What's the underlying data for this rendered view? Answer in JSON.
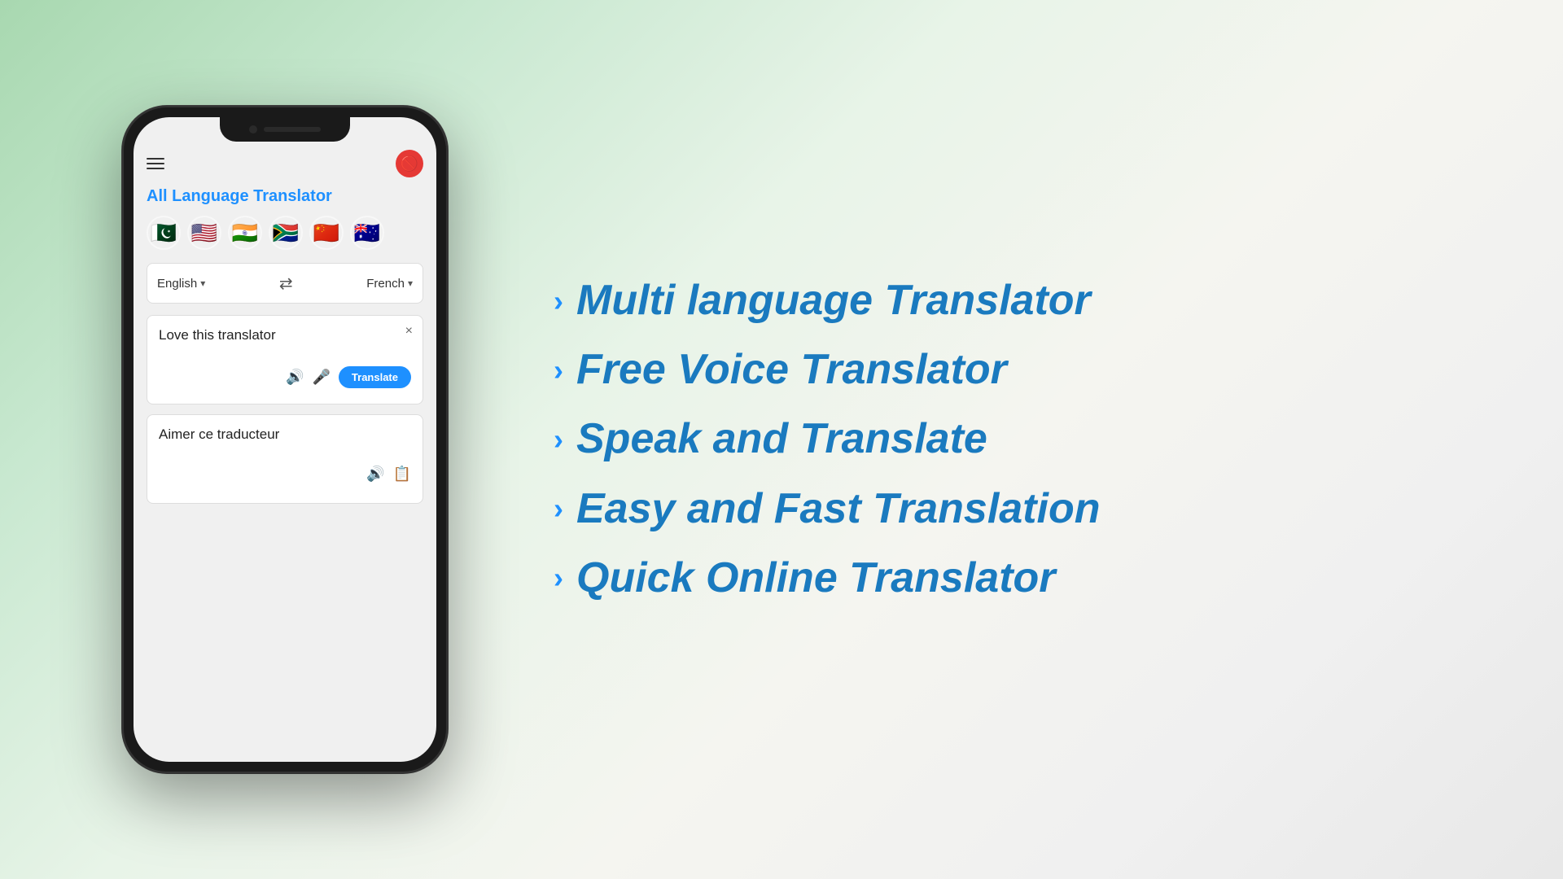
{
  "app": {
    "title": "All Language Translator",
    "menu_icon": "☰",
    "no_icon": "🚫"
  },
  "flags": [
    {
      "emoji": "🇵🇰",
      "name": "Pakistan"
    },
    {
      "emoji": "🇺🇸",
      "name": "USA"
    },
    {
      "emoji": "🇮🇳",
      "name": "India"
    },
    {
      "emoji": "🇿🇦",
      "name": "South Africa"
    },
    {
      "emoji": "🇨🇳",
      "name": "China"
    },
    {
      "emoji": "🇦🇺",
      "name": "Australia"
    }
  ],
  "translator": {
    "source_lang": "English",
    "target_lang": "French",
    "source_text": "Love this translator",
    "translated_text": "Aimer ce traducteur",
    "translate_button": "Translate",
    "close_symbol": "×",
    "swap_symbol": "⇄"
  },
  "features": [
    {
      "text": "Multi language Translator"
    },
    {
      "text": "Free Voice Translator"
    },
    {
      "text": "Speak and Translate"
    },
    {
      "text": "Easy and Fast Translation"
    },
    {
      "text": "Quick Online Translator"
    }
  ],
  "chevron": "›",
  "icons": {
    "volume": "🔊",
    "mic": "🎤",
    "copy": "📋",
    "menu": "☰",
    "no": "🚫",
    "swap": "⇄"
  }
}
